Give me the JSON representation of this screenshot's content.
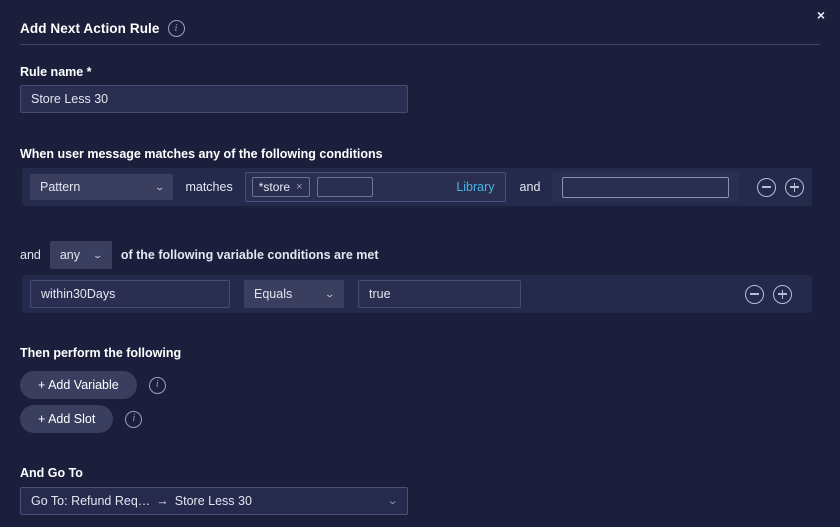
{
  "dialog": {
    "title": "Add Next Action Rule",
    "title_info_icon": "info-icon",
    "close_icon": "×"
  },
  "rule_name": {
    "label": "Rule name *",
    "value": "Store Less 30",
    "placeholder": ""
  },
  "message_conditions": {
    "label": "When user message matches any of the following conditions",
    "row": {
      "type_select": "Pattern",
      "operator_text": "matches",
      "chip_label": "*store",
      "chip_remove_icon": "×",
      "chip_input_value": "",
      "library_link": "Library",
      "conjunction": "and",
      "second_input_value": "",
      "remove_icon": "minus-circle-icon",
      "add_icon": "plus-circle-icon"
    }
  },
  "variable_conditions": {
    "prefix": "and",
    "quantifier": "any",
    "suffix": "of the following variable conditions are met",
    "row": {
      "variable_name": "within30Days",
      "comparator": "Equals",
      "value": "true",
      "remove_icon": "minus-circle-icon",
      "add_icon": "plus-circle-icon"
    }
  },
  "perform": {
    "label": "Then perform the following",
    "add_variable_label": "+ Add Variable",
    "add_slot_label": "+ Add Slot"
  },
  "go_to": {
    "label": "And Go To",
    "source": "Go To: Refund Req…",
    "arrow": "→",
    "target": "Store Less 30",
    "chevron_icon": "chevron-down-icon"
  },
  "colors": {
    "background": "#1b1f3b",
    "row_background": "#242a4c",
    "input_background": "#2a2f52",
    "control_background": "#3a3f5f",
    "link": "#46b4e4",
    "text": "#e8eaf2"
  }
}
